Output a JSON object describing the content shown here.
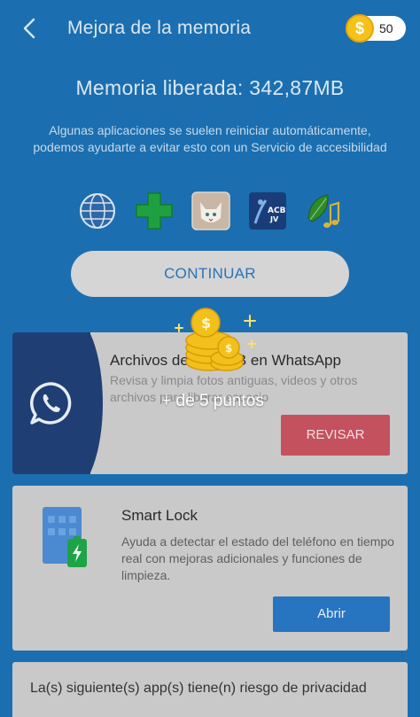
{
  "header": {
    "title": "Mejora de la memoria",
    "coins": "50",
    "coin_symbol": "$"
  },
  "summary": {
    "freed": "Memoria liberada: 342,87MB",
    "description": "Algunas aplicaciones se suelen reiniciar automáticamente, podemos ayudarte a evitar esto con un Servicio de accesibilidad"
  },
  "apps": [
    {
      "icon": "globe-app-icon"
    },
    {
      "icon": "green-cross-app-icon"
    },
    {
      "icon": "cat-app-icon"
    },
    {
      "icon": "acb-jv-app-icon",
      "label": "ACB JV"
    },
    {
      "icon": "music-leaf-app-icon"
    }
  ],
  "continue_label": "CONTINUAR",
  "whatsapp_card": {
    "title": "Archivos de 3,1MB en WhatsApp",
    "title_visible_start": "Archivos de",
    "title_visible_end": "B en WhatsApp",
    "body": "Revisa y limpia fotos antiguas, videos y otros archivos para liberar espacio",
    "button": "REVISAR"
  },
  "smartlock_card": {
    "title": "Smart Lock",
    "body": "Ayuda a detectar el estado del teléfono en tiempo real con mejoras adicionales y funciones de limpieza.",
    "button": "Abrir"
  },
  "privacy_card": {
    "title": "La(s) siguiente(s) app(s) tiene(n) riesgo de privacidad"
  },
  "reward": {
    "text": "+ de 5 puntos"
  },
  "colors": {
    "background": "#1b6fb0",
    "card": "#c9c9c9",
    "whatsapp_panel": "#1f3f74",
    "revisar": "#c4515e",
    "abrir": "#2775c0",
    "coin": "#f6c21a"
  }
}
